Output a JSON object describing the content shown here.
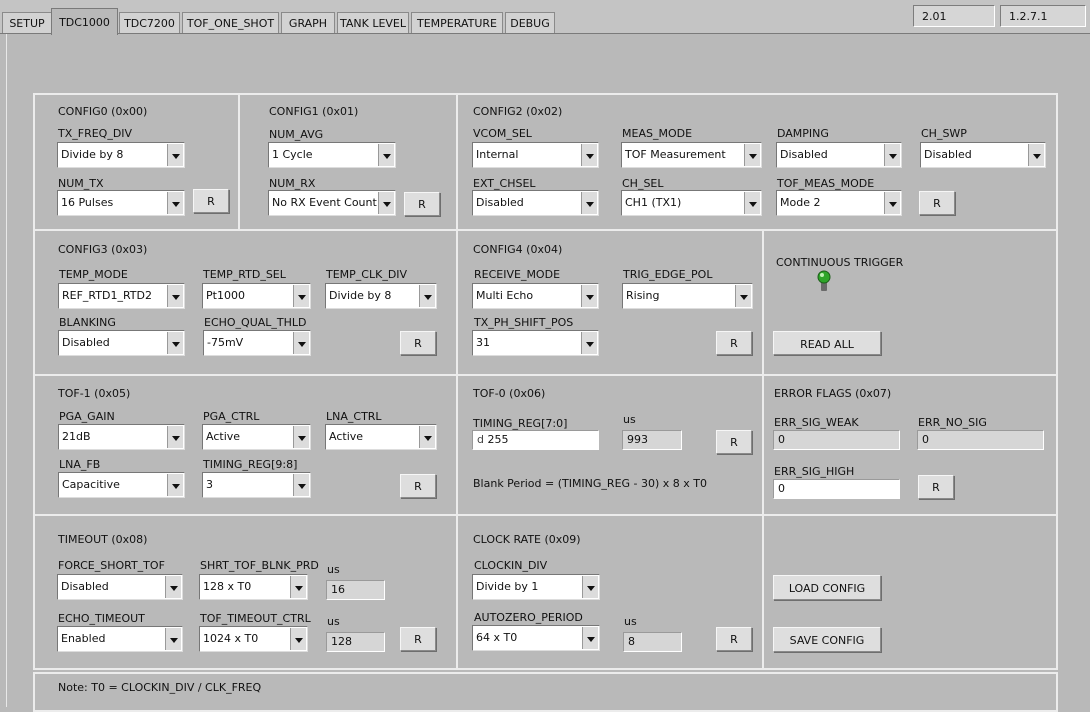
{
  "tabs": [
    "SETUP",
    "TDC1000",
    "TDC7200",
    "TOF_ONE_SHOT",
    "GRAPH",
    "TANK LEVEL",
    "TEMPERATURE",
    "DEBUG"
  ],
  "versions": {
    "left": "2.01",
    "right": "1.2.7.1"
  },
  "config0": {
    "title": "CONFIG0 (0x00)",
    "tx_freq_div_label": "TX_FREQ_DIV",
    "tx_freq_div": "Divide by 8",
    "num_tx_label": "NUM_TX",
    "num_tx": "16 Pulses",
    "r": "R"
  },
  "config1": {
    "title": "CONFIG1 (0x01)",
    "num_avg_label": "NUM_AVG",
    "num_avg": "1 Cycle",
    "num_rx_label": "NUM_RX",
    "num_rx": "No RX Event Count",
    "r": "R"
  },
  "config2": {
    "title": "CONFIG2 (0x02)",
    "vcom_sel_label": "VCOM_SEL",
    "vcom_sel": "Internal",
    "meas_mode_label": "MEAS_MODE",
    "meas_mode": "TOF Measurement",
    "damping_label": "DAMPING",
    "damping": "Disabled",
    "ch_swp_label": "CH_SWP",
    "ch_swp": "Disabled",
    "ext_chsel_label": "EXT_CHSEL",
    "ext_chsel": "Disabled",
    "ch_sel_label": "CH_SEL",
    "ch_sel": "CH1 (TX1)",
    "tof_meas_mode_label": "TOF_MEAS_MODE",
    "tof_meas_mode": "Mode 2",
    "r": "R"
  },
  "config3": {
    "title": "CONFIG3 (0x03)",
    "temp_mode_label": "TEMP_MODE",
    "temp_mode": "REF_RTD1_RTD2",
    "temp_rtd_sel_label": "TEMP_RTD_SEL",
    "temp_rtd_sel": "Pt1000",
    "temp_clk_div_label": "TEMP_CLK_DIV",
    "temp_clk_div": "Divide by 8",
    "blanking_label": "BLANKING",
    "blanking": "Disabled",
    "echo_qual_thld_label": "ECHO_QUAL_THLD",
    "echo_qual_thld": "-75mV",
    "r": "R"
  },
  "config4": {
    "title": "CONFIG4 (0x04)",
    "receive_mode_label": "RECEIVE_MODE",
    "receive_mode": "Multi Echo",
    "trig_edge_pol_label": "TRIG_EDGE_POL",
    "trig_edge_pol": "Rising",
    "tx_ph_shift_pos_label": "TX_PH_SHIFT_POS",
    "tx_ph_shift_pos": "31",
    "r": "R"
  },
  "trigger": {
    "label": "CONTINUOUS TRIGGER",
    "read_all": "READ ALL"
  },
  "tof1": {
    "title": "TOF-1 (0x05)",
    "pga_gain_label": "PGA_GAIN",
    "pga_gain": "21dB",
    "pga_ctrl_label": "PGA_CTRL",
    "pga_ctrl": "Active",
    "lna_ctrl_label": "LNA_CTRL",
    "lna_ctrl": "Active",
    "lna_fb_label": "LNA_FB",
    "lna_fb": "Capacitive",
    "timing_reg_hi_label": "TIMING_REG[9:8]",
    "timing_reg_hi": "3",
    "r": "R"
  },
  "tof0": {
    "title": "TOF-0 (0x06)",
    "timing_reg_lo_label": "TIMING_REG[7:0]",
    "timing_reg_lo_prefix": "d",
    "timing_reg_lo": "255",
    "us_label": "us",
    "us_value": "993",
    "r": "R",
    "formula": "Blank Period = (TIMING_REG - 30) x 8 x T0"
  },
  "errors": {
    "title": "ERROR FLAGS (0x07)",
    "err_sig_weak_label": "ERR_SIG_WEAK",
    "err_sig_weak": "0",
    "err_no_sig_label": "ERR_NO_SIG",
    "err_no_sig": "0",
    "err_sig_high_label": "ERR_SIG_HIGH",
    "err_sig_high": "0",
    "r": "R"
  },
  "timeout": {
    "title": "TIMEOUT (0x08)",
    "force_short_tof_label": "FORCE_SHORT_TOF",
    "force_short_tof": "Disabled",
    "shrt_tof_blnk_prd_label": "SHRT_TOF_BLNK_PRD",
    "shrt_tof_blnk_prd": "128 x T0",
    "us1_label": "us",
    "us1": "16",
    "echo_timeout_label": "ECHO_TIMEOUT",
    "echo_timeout": "Enabled",
    "tof_timeout_ctrl_label": "TOF_TIMEOUT_CTRL",
    "tof_timeout_ctrl": "1024 x T0",
    "us2_label": "us",
    "us2": "128",
    "r": "R"
  },
  "clock": {
    "title": "CLOCK RATE (0x09)",
    "clockin_div_label": "CLOCKIN_DIV",
    "clockin_div": "Divide by 1",
    "autozero_period_label": "AUTOZERO_PERIOD",
    "autozero_period": "64 x T0",
    "us_label": "us",
    "us_value": "8",
    "r": "R"
  },
  "config_buttons": {
    "load": "LOAD CONFIG",
    "save": "SAVE CONFIG"
  },
  "note": "Note: T0 = CLOCKIN_DIV / CLK_FREQ",
  "colors": {
    "panel": "#b9b9b9",
    "led": "#2fa52a"
  }
}
